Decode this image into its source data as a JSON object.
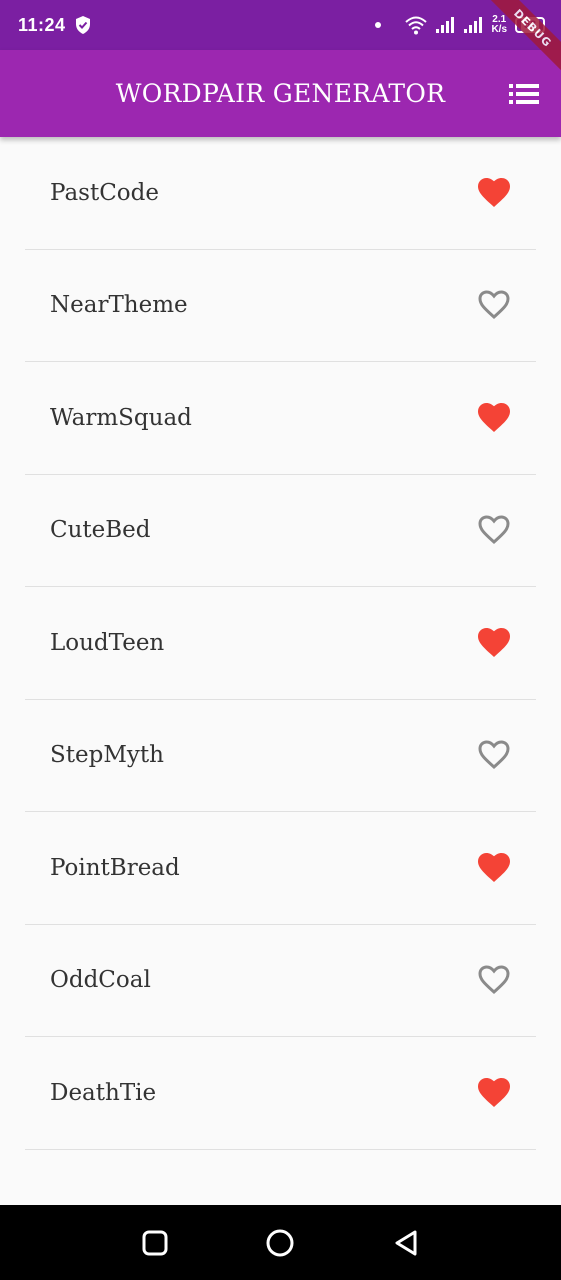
{
  "status": {
    "time": "11:24",
    "speed_top": "2.1",
    "speed_bottom": "K/s",
    "battery": "53"
  },
  "debug_label": "DEBUG",
  "app_bar": {
    "title": "WORDPAIR GENERATOR",
    "action_icon": "list-icon"
  },
  "colors": {
    "status_bar": "#7b1fa2",
    "app_bar": "#9c27b0",
    "heart_saved": "#f44336",
    "heart_unsaved": "#8a8a8a"
  },
  "words": [
    {
      "text": "PastCode",
      "saved": true
    },
    {
      "text": "NearTheme",
      "saved": false
    },
    {
      "text": "WarmSquad",
      "saved": true
    },
    {
      "text": "CuteBed",
      "saved": false
    },
    {
      "text": "LoudTeen",
      "saved": true
    },
    {
      "text": "StepMyth",
      "saved": false
    },
    {
      "text": "PointBread",
      "saved": true
    },
    {
      "text": "OddCoal",
      "saved": false
    },
    {
      "text": "DeathTie",
      "saved": true
    }
  ],
  "nav": {
    "recents_icon": "square-icon",
    "home_icon": "circle-icon",
    "back_icon": "triangle-back-icon"
  }
}
